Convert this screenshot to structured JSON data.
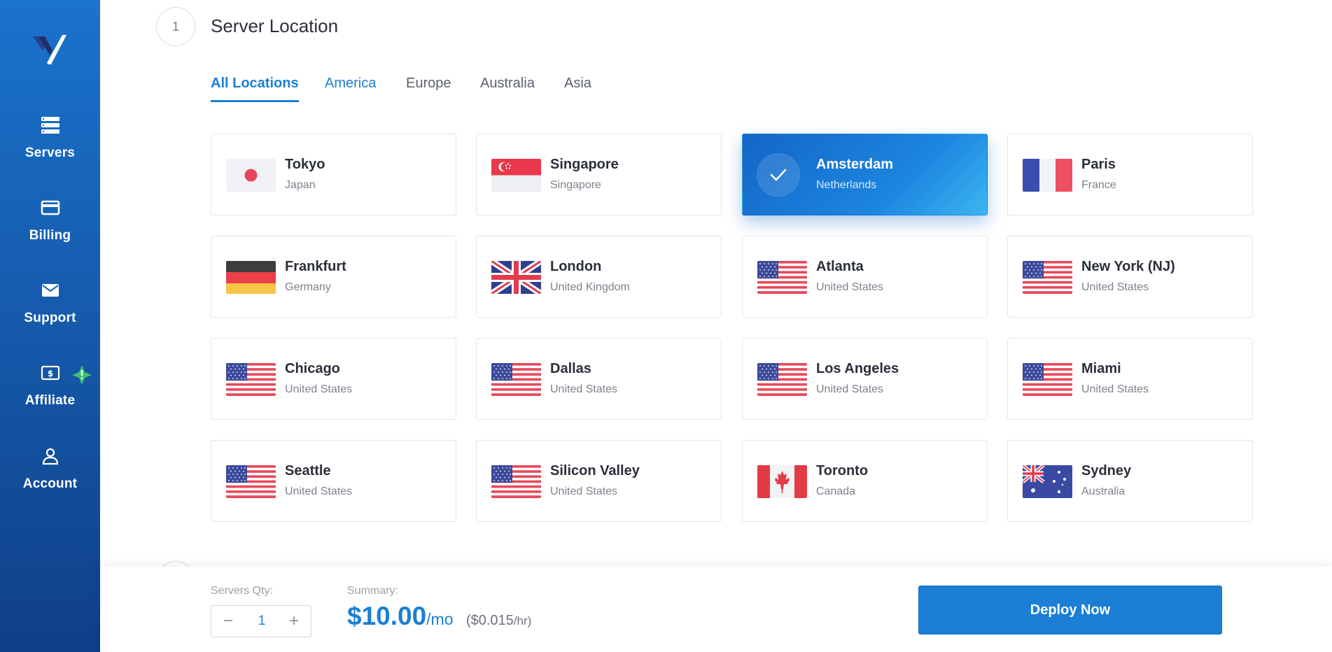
{
  "sidebar": {
    "items": [
      {
        "label": "Servers",
        "icon": "servers-icon"
      },
      {
        "label": "Billing",
        "icon": "credit-card-icon"
      },
      {
        "label": "Support",
        "icon": "envelope-icon"
      },
      {
        "label": "Affiliate",
        "icon": "dollar-bill-icon"
      },
      {
        "label": "Account",
        "icon": "user-icon"
      }
    ]
  },
  "section": {
    "step": "1",
    "title": "Server Location"
  },
  "tabs": [
    {
      "label": "All Locations",
      "state": "active"
    },
    {
      "label": "America",
      "state": "hover"
    },
    {
      "label": "Europe",
      "state": "normal"
    },
    {
      "label": "Australia",
      "state": "normal"
    },
    {
      "label": "Asia",
      "state": "normal"
    }
  ],
  "locations": [
    {
      "city": "Tokyo",
      "country": "Japan",
      "flag": "jp"
    },
    {
      "city": "Singapore",
      "country": "Singapore",
      "flag": "sg"
    },
    {
      "city": "Amsterdam",
      "country": "Netherlands",
      "flag": "nl",
      "selected": true
    },
    {
      "city": "Paris",
      "country": "France",
      "flag": "fr"
    },
    {
      "city": "Frankfurt",
      "country": "Germany",
      "flag": "de"
    },
    {
      "city": "London",
      "country": "United Kingdom",
      "flag": "gb"
    },
    {
      "city": "Atlanta",
      "country": "United States",
      "flag": "us"
    },
    {
      "city": "New York (NJ)",
      "country": "United States",
      "flag": "us"
    },
    {
      "city": "Chicago",
      "country": "United States",
      "flag": "us"
    },
    {
      "city": "Dallas",
      "country": "United States",
      "flag": "us"
    },
    {
      "city": "Los Angeles",
      "country": "United States",
      "flag": "us"
    },
    {
      "city": "Miami",
      "country": "United States",
      "flag": "us"
    },
    {
      "city": "Seattle",
      "country": "United States",
      "flag": "us"
    },
    {
      "city": "Silicon Valley",
      "country": "United States",
      "flag": "us"
    },
    {
      "city": "Toronto",
      "country": "Canada",
      "flag": "ca"
    },
    {
      "city": "Sydney",
      "country": "Australia",
      "flag": "au"
    }
  ],
  "footer": {
    "qty_label": "Servers Qty:",
    "qty_value": "1",
    "minus": "−",
    "plus": "+",
    "summary_label": "Summary:",
    "price": "$10.00",
    "per": "/mo",
    "hourly_open": "($0.015",
    "hourly_unit": "/hr)",
    "deploy_label": "Deploy Now"
  },
  "colors": {
    "accent": "#1b7fd6",
    "sidebar_top": "#1a73cc",
    "sidebar_bottom": "#0f3f86",
    "badge": "#3cc46d"
  }
}
